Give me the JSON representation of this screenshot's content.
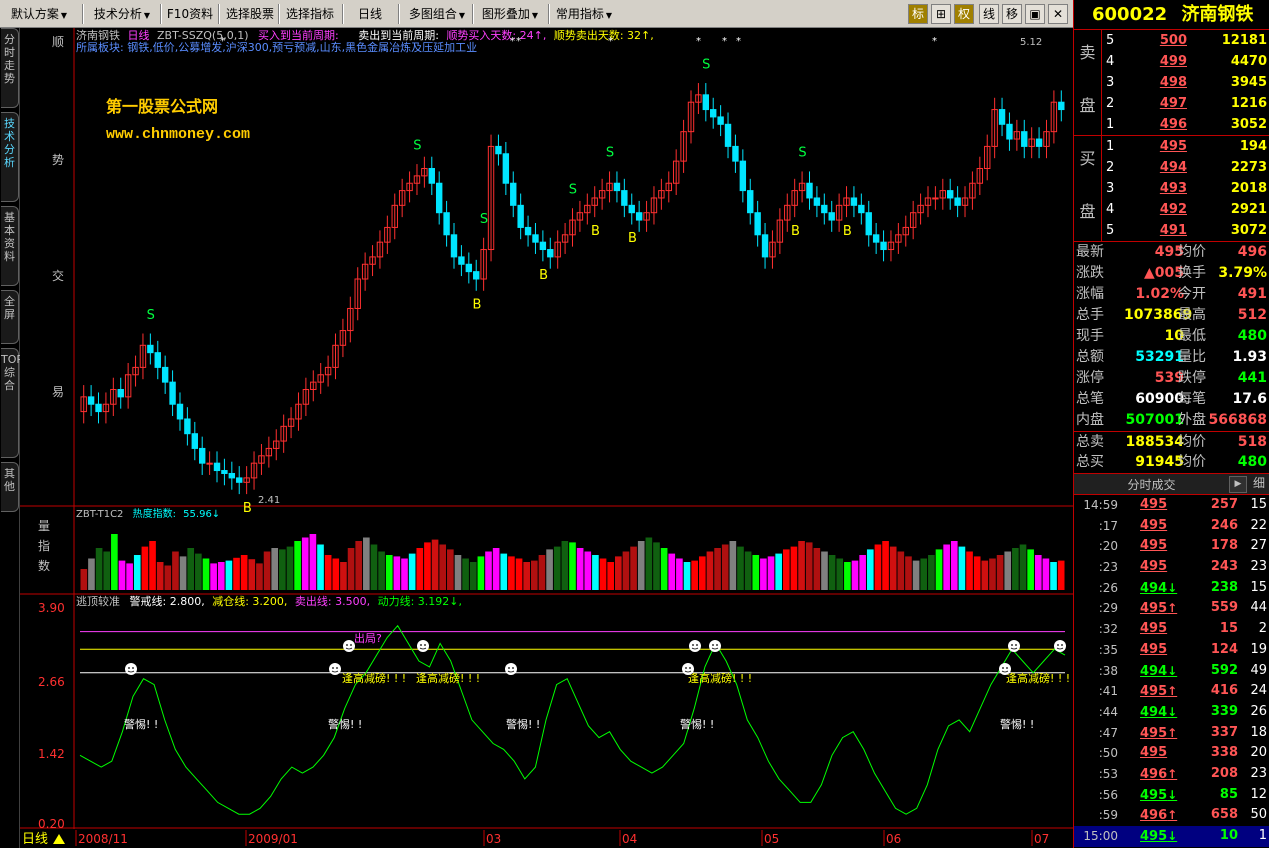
{
  "toolbar": {
    "items": [
      "默认方案",
      "技术分析",
      "F10资料",
      "选择股票",
      "选择指标",
      "日线",
      "多图组合",
      "图形叠加",
      "常用指标"
    ],
    "icons": [
      "标",
      "⊞",
      "权",
      "线",
      "移",
      "▣",
      "✕"
    ]
  },
  "sidetabs": [
    "分时走势",
    "技术分析",
    "基本资料",
    "全屏",
    "TOP综合",
    "其他"
  ],
  "side_labels": {
    "main": [
      "顺",
      "势",
      "交",
      "易"
    ],
    "vol": [
      "量",
      "指",
      "数"
    ]
  },
  "main_chart": {
    "header_stock": "济南钢铁",
    "header_period": "日线",
    "header_formula": "ZBT-SSZQ(5,0,1)",
    "header_buy_label": "买入到当前周期:",
    "header_sell_label": "卖出到当前周期:",
    "header_trend_buy": "顺势买入天数: 24↑,",
    "header_trend_sell": "顺势卖出天数: 32↑,",
    "header_sectors": "所属板块: 钢铁,低价,公募增发,沪深300,预亏预减,山东,黑色金属冶炼及压延加工业",
    "watermark_1": "第一股票公式网",
    "watermark_2": "www.chnmoney.com",
    "price_high_label": "5.12",
    "price_low_label": "2.41",
    "up_color": "#ff3030",
    "down_color": "#00e5ff"
  },
  "vol_chart": {
    "title": "ZBT-T1C2",
    "heat_label": "热度指数:",
    "heat_value": "55.96↓"
  },
  "osc_chart": {
    "title": "逃顶较准",
    "warn_label": "警戒线: 2.800,",
    "reduce_label": "减仓线: 3.200,",
    "sell_label": "卖出线: 3.500,",
    "power_label": "动力线: 3.192↓,",
    "yticks": [
      "3.90",
      "2.66",
      "1.42",
      "0.20"
    ],
    "alert_warn": "警惕! !",
    "alert_reduce": "逢高减磅! ! !",
    "alert_exit": "出局?"
  },
  "xaxis": {
    "period": "日线",
    "labels": [
      "2008/11",
      "2009/01",
      "03",
      "04",
      "05",
      "06",
      "07"
    ]
  },
  "chart_data": [
    {
      "type": "candlestick",
      "title": "济南钢铁 日线",
      "series": [
        {
          "name": "open",
          "values": [
            2.9,
            3.0,
            2.95,
            2.9,
            2.95,
            3.05,
            3.0,
            3.15,
            3.2,
            3.35,
            3.3,
            3.2,
            3.1,
            2.95,
            2.85,
            2.75,
            2.65,
            2.55,
            2.55,
            2.5,
            2.48,
            2.45,
            2.42,
            2.45,
            2.55,
            2.6,
            2.65,
            2.7,
            2.8,
            2.85,
            2.95,
            3.05,
            3.1,
            3.15,
            3.2,
            3.35,
            3.45,
            3.6,
            3.8,
            3.9,
            3.95,
            4.05,
            4.15,
            4.3,
            4.4,
            4.45,
            4.5,
            4.55,
            4.45,
            4.25,
            4.1,
            3.95,
            3.9,
            3.85,
            3.8,
            4.0,
            4.7,
            4.65,
            4.45,
            4.3,
            4.15,
            4.1,
            4.05,
            4.0,
            3.95,
            4.05,
            4.1,
            4.2,
            4.25,
            4.3,
            4.35,
            4.4,
            4.45,
            4.4,
            4.3,
            4.25,
            4.2,
            4.25,
            4.35,
            4.4,
            4.45,
            4.6,
            4.8,
            5.0,
            5.05,
            4.95,
            4.9,
            4.85,
            4.7,
            4.6,
            4.4,
            4.25,
            4.1,
            3.95,
            4.05,
            4.2,
            4.3,
            4.4,
            4.45,
            4.35,
            4.3,
            4.25,
            4.2,
            4.3,
            4.35,
            4.3,
            4.25,
            4.1,
            4.05,
            4.0,
            4.05,
            4.1,
            4.15,
            4.25,
            4.3,
            4.35,
            4.35,
            4.4,
            4.35,
            4.3,
            4.35,
            4.45,
            4.55,
            4.7,
            4.95,
            4.85,
            4.75,
            4.8,
            4.7,
            4.75,
            4.7,
            4.8,
            5.0
          ]
        },
        {
          "name": "close",
          "values": [
            3.0,
            2.95,
            2.9,
            2.95,
            3.05,
            3.0,
            3.15,
            3.2,
            3.35,
            3.3,
            3.2,
            3.1,
            2.95,
            2.85,
            2.75,
            2.65,
            2.55,
            2.55,
            2.5,
            2.48,
            2.45,
            2.42,
            2.45,
            2.55,
            2.6,
            2.65,
            2.7,
            2.8,
            2.85,
            2.95,
            3.05,
            3.1,
            3.15,
            3.2,
            3.35,
            3.45,
            3.6,
            3.8,
            3.9,
            3.95,
            4.05,
            4.15,
            4.3,
            4.4,
            4.45,
            4.5,
            4.55,
            4.45,
            4.25,
            4.1,
            3.95,
            3.9,
            3.85,
            3.8,
            4.0,
            4.7,
            4.65,
            4.45,
            4.3,
            4.15,
            4.1,
            4.05,
            4.0,
            3.95,
            4.05,
            4.1,
            4.2,
            4.25,
            4.3,
            4.35,
            4.4,
            4.45,
            4.4,
            4.3,
            4.25,
            4.2,
            4.25,
            4.35,
            4.4,
            4.45,
            4.6,
            4.8,
            5.0,
            5.05,
            4.95,
            4.9,
            4.85,
            4.7,
            4.6,
            4.4,
            4.25,
            4.1,
            3.95,
            4.05,
            4.2,
            4.3,
            4.4,
            4.45,
            4.35,
            4.3,
            4.25,
            4.2,
            4.3,
            4.35,
            4.3,
            4.25,
            4.1,
            4.05,
            4.0,
            4.05,
            4.1,
            4.15,
            4.25,
            4.3,
            4.35,
            4.35,
            4.4,
            4.35,
            4.3,
            4.35,
            4.45,
            4.55,
            4.7,
            4.95,
            4.85,
            4.75,
            4.8,
            4.7,
            4.75,
            4.7,
            4.8,
            5.0,
            4.95
          ]
        }
      ],
      "ylim": [
        2.3,
        5.3
      ],
      "markers": [
        {
          "label": "S",
          "index": 9
        },
        {
          "label": "B",
          "index": 22
        },
        {
          "label": "S",
          "index": 45
        },
        {
          "label": "B",
          "index": 53
        },
        {
          "label": "S",
          "index": 54
        },
        {
          "label": "B",
          "index": 62
        },
        {
          "label": "S",
          "index": 66
        },
        {
          "label": "B",
          "index": 69
        },
        {
          "label": "S",
          "index": 71
        },
        {
          "label": "B",
          "index": 74
        },
        {
          "label": "S",
          "index": 84
        },
        {
          "label": "B",
          "index": 96
        },
        {
          "label": "S",
          "index": 97
        },
        {
          "label": "B",
          "index": 103
        }
      ]
    },
    {
      "type": "bar",
      "title": "ZBT-T1C2",
      "values": [
        30,
        45,
        60,
        55,
        80,
        42,
        38,
        50,
        62,
        70,
        40,
        35,
        55,
        48,
        60,
        52,
        45,
        38,
        40,
        42,
        46,
        50,
        44,
        38,
        55,
        60,
        58,
        62,
        70,
        75,
        80,
        65,
        50,
        45,
        40,
        60,
        70,
        75,
        65,
        55,
        50,
        48,
        45,
        52,
        60,
        68,
        72,
        65,
        58,
        50,
        45,
        40,
        48,
        55,
        60,
        52,
        48,
        45,
        40,
        42,
        50,
        58,
        62,
        70,
        68,
        60,
        55,
        50,
        45,
        40,
        48,
        55,
        62,
        70,
        75,
        68,
        60,
        52,
        45,
        40,
        42,
        48,
        55,
        60,
        65,
        70,
        62,
        55,
        50,
        45,
        48,
        52,
        58,
        62,
        70,
        68,
        60,
        55,
        50,
        45,
        40,
        42,
        50,
        58,
        65,
        70,
        62,
        55,
        48,
        42,
        45,
        50,
        58,
        65,
        70,
        62,
        55,
        48,
        42,
        45,
        50,
        55,
        60,
        65,
        58,
        50,
        45,
        40,
        42
      ],
      "ylim": [
        0,
        100
      ]
    },
    {
      "type": "line",
      "title": "逃顶较准",
      "values": [
        1.4,
        1.3,
        1.2,
        1.3,
        1.8,
        2.4,
        2.7,
        2.6,
        2.0,
        1.5,
        1.2,
        1.0,
        0.8,
        0.6,
        0.5,
        0.4,
        0.4,
        0.5,
        0.7,
        1.0,
        1.2,
        1.1,
        1.2,
        1.4,
        1.7,
        2.2,
        2.6,
        2.8,
        3.1,
        3.4,
        3.6,
        3.3,
        3.0,
        2.9,
        3.3,
        3.0,
        2.5,
        2.0,
        1.8,
        1.6,
        1.5,
        1.3,
        1.0,
        1.2,
        2.0,
        2.6,
        2.7,
        2.3,
        1.9,
        1.7,
        1.8,
        1.5,
        1.3,
        1.2,
        1.1,
        1.2,
        1.4,
        1.6,
        2.2,
        2.9,
        3.3,
        3.0,
        2.6,
        2.0,
        1.7,
        1.3,
        1.0,
        0.8,
        0.6,
        0.6,
        0.9,
        1.4,
        1.7,
        1.8,
        1.5,
        1.1,
        0.8,
        0.5,
        0.4,
        0.5,
        0.9,
        1.5,
        1.9,
        2.0,
        1.8,
        2.2,
        2.6,
        2.9,
        3.2,
        3.0,
        2.8,
        3.0,
        3.2,
        3.1
      ],
      "ylim": [
        0.2,
        3.9
      ],
      "reference_lines": [
        {
          "name": "警戒线",
          "value": 2.8
        },
        {
          "name": "减仓线",
          "value": 3.2
        },
        {
          "name": "卖出线",
          "value": 3.5
        }
      ],
      "current_value": 3.192
    }
  ],
  "quote": {
    "code": "600022",
    "name": "济南钢铁",
    "sell_label": [
      "卖",
      "盘"
    ],
    "buy_label": [
      "买",
      "盘"
    ],
    "asks": [
      {
        "lvl": "5",
        "price": "500",
        "vol": "12181"
      },
      {
        "lvl": "4",
        "price": "499",
        "vol": "4470"
      },
      {
        "lvl": "3",
        "price": "498",
        "vol": "3945"
      },
      {
        "lvl": "2",
        "price": "497",
        "vol": "1216"
      },
      {
        "lvl": "1",
        "price": "496",
        "vol": "3052"
      }
    ],
    "bids": [
      {
        "lvl": "1",
        "price": "495",
        "vol": "194"
      },
      {
        "lvl": "2",
        "price": "494",
        "vol": "2273"
      },
      {
        "lvl": "3",
        "price": "493",
        "vol": "2018"
      },
      {
        "lvl": "4",
        "price": "492",
        "vol": "2921"
      },
      {
        "lvl": "5",
        "price": "491",
        "vol": "3072"
      }
    ],
    "stats": [
      {
        "l": "最新",
        "v": "495",
        "vc": "red",
        "l2": "均价",
        "v2": "496",
        "v2c": "red"
      },
      {
        "l": "涨跌",
        "v": "▲005",
        "vc": "red",
        "l2": "换手",
        "v2": "3.79%",
        "v2c": "yel"
      },
      {
        "l": "涨幅",
        "v": "1.02%",
        "vc": "red",
        "l2": "今开",
        "v2": "491",
        "v2c": "red"
      },
      {
        "l": "总手",
        "v": "1073869",
        "vc": "yel",
        "l2": "最高",
        "v2": "512",
        "v2c": "red"
      },
      {
        "l": "现手",
        "v": "10",
        "vc": "yel",
        "l2": "最低",
        "v2": "480",
        "v2c": "grn"
      },
      {
        "l": "总额",
        "v": "53291",
        "vc": "cy",
        "l2": "量比",
        "v2": "1.93",
        "v2c": "wh"
      },
      {
        "l": "涨停",
        "v": "539",
        "vc": "red",
        "l2": "跌停",
        "v2": "441",
        "v2c": "grn"
      },
      {
        "l": "总笔",
        "v": "60900",
        "vc": "wh",
        "l2": "每笔",
        "v2": "17.6",
        "v2c": "wh"
      },
      {
        "l": "内盘",
        "v": "507001",
        "vc": "grn",
        "l2": "外盘",
        "v2": "566868",
        "v2c": "red"
      },
      {
        "l": "总卖",
        "v": "188534",
        "vc": "yel",
        "l2": "均价",
        "v2": "518",
        "v2c": "red",
        "sep": true
      },
      {
        "l": "总买",
        "v": "91945",
        "vc": "yel",
        "l2": "均价",
        "v2": "480",
        "v2c": "grn"
      }
    ],
    "ticks_title": "分时成交",
    "ticks_btn": "细",
    "ticks": [
      {
        "t": "14:59",
        "p": "495",
        "a": "",
        "v": "257",
        "c": "15",
        "col": "red"
      },
      {
        "t": ":17",
        "p": "495",
        "a": "",
        "v": "246",
        "c": "22",
        "col": "red"
      },
      {
        "t": ":20",
        "p": "495",
        "a": "",
        "v": "178",
        "c": "27",
        "col": "red"
      },
      {
        "t": ":23",
        "p": "495",
        "a": "",
        "v": "243",
        "c": "23",
        "col": "red"
      },
      {
        "t": ":26",
        "p": "494",
        "a": "↓",
        "v": "238",
        "c": "15",
        "col": "grn"
      },
      {
        "t": ":29",
        "p": "495",
        "a": "↑",
        "v": "559",
        "c": "44",
        "col": "red"
      },
      {
        "t": ":32",
        "p": "495",
        "a": "",
        "v": "15",
        "c": "2",
        "col": "red"
      },
      {
        "t": ":35",
        "p": "495",
        "a": "",
        "v": "124",
        "c": "19",
        "col": "red"
      },
      {
        "t": ":38",
        "p": "494",
        "a": "↓",
        "v": "592",
        "c": "49",
        "col": "grn"
      },
      {
        "t": ":41",
        "p": "495",
        "a": "↑",
        "v": "416",
        "c": "24",
        "col": "red"
      },
      {
        "t": ":44",
        "p": "494",
        "a": "↓",
        "v": "339",
        "c": "26",
        "col": "grn"
      },
      {
        "t": ":47",
        "p": "495",
        "a": "↑",
        "v": "337",
        "c": "18",
        "col": "red"
      },
      {
        "t": ":50",
        "p": "495",
        "a": "",
        "v": "338",
        "c": "20",
        "col": "red"
      },
      {
        "t": ":53",
        "p": "496",
        "a": "↑",
        "v": "208",
        "c": "23",
        "col": "red"
      },
      {
        "t": ":56",
        "p": "495",
        "a": "↓",
        "v": "85",
        "c": "12",
        "col": "grn"
      },
      {
        "t": ":59",
        "p": "496",
        "a": "↑",
        "v": "658",
        "c": "50",
        "col": "red"
      },
      {
        "t": "15:00",
        "p": "495",
        "a": "↓",
        "v": "10",
        "c": "1",
        "col": "grn",
        "last": true
      }
    ]
  }
}
